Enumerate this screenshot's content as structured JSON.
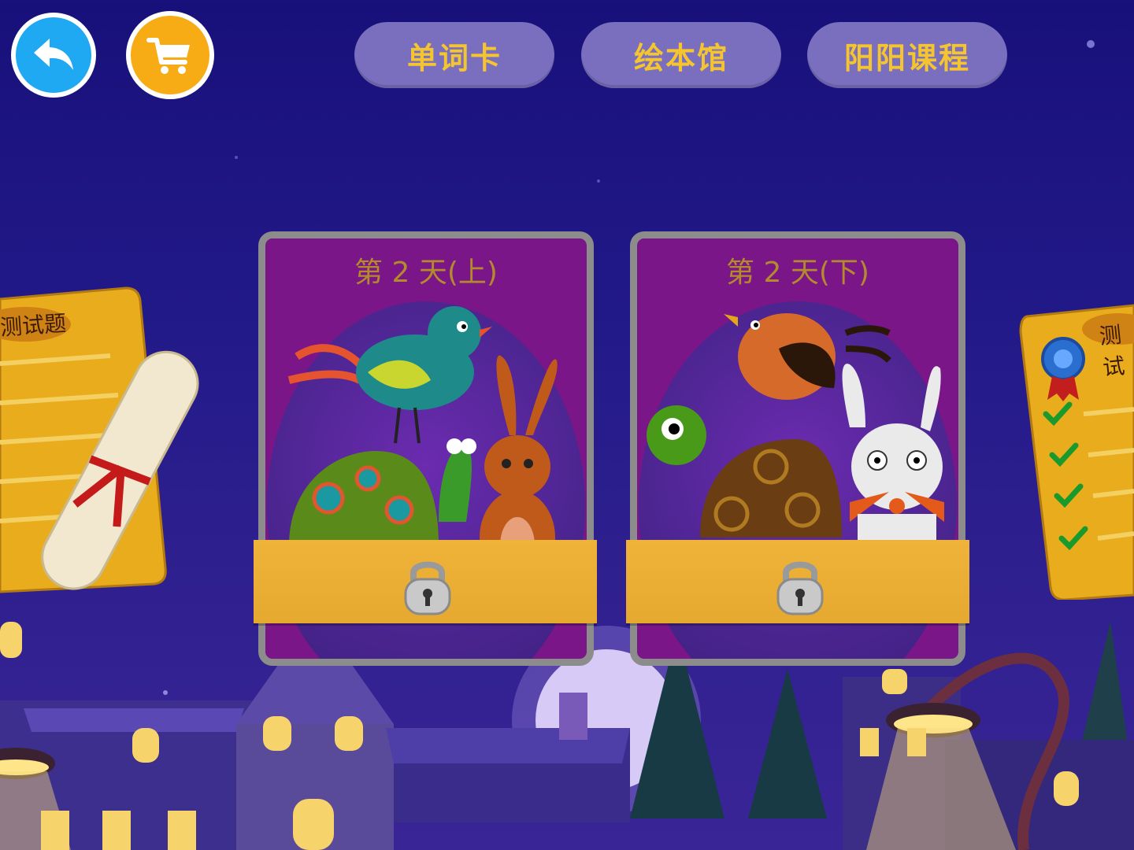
{
  "top_nav": {
    "back_icon": "back-arrow-icon",
    "cart_icon": "shopping-cart-icon",
    "tabs": [
      {
        "label": "单词卡"
      },
      {
        "label": "绘本馆"
      },
      {
        "label": "阳阳课程"
      }
    ]
  },
  "lessons": [
    {
      "title": "第 2 天(上)",
      "locked": true,
      "lock_icon": "padlock-icon"
    },
    {
      "title": "第 2 天(下)",
      "locked": true,
      "lock_icon": "padlock-icon"
    }
  ],
  "side_cards": {
    "left_label": "测试题",
    "right_label": "测试"
  },
  "colors": {
    "sky": "#1c1480",
    "nav_pill": "#7a6fbe",
    "nav_text": "#f5c530",
    "card_bg": "#7a1687",
    "card_title": "#b38a2c",
    "lock_band": "#f0b33a",
    "back_button": "#1fa9f2",
    "cart_button": "#f7ac16"
  }
}
